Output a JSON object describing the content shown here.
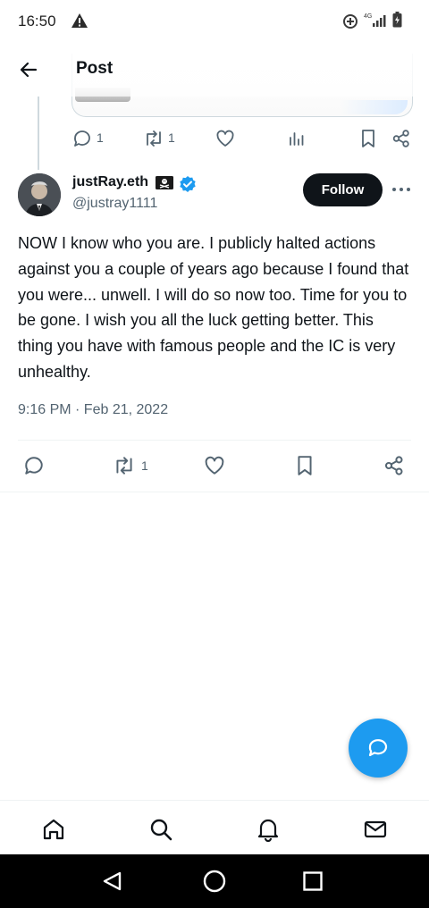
{
  "status_bar": {
    "time": "16:50",
    "network_label": "4G"
  },
  "header": {
    "title": "Post"
  },
  "quoted_post_actions": {
    "replies": "1",
    "reposts": "1"
  },
  "post": {
    "display_name": "justRay.eth",
    "handle": "@justray1111",
    "follow_label": "Follow",
    "text": "NOW I know who you are. I publicly halted actions against you a couple of years ago because I found that you were... unwell. I will do so now too. Time for you to be gone. I wish you all the luck getting better. This thing you have with famous people and the IC is very unhealthy.",
    "timestamp": "9:16 PM · Feb 21, 2022",
    "reposts": "1"
  },
  "colors": {
    "accent": "#1d9bf0",
    "text": "#0f1419",
    "muted": "#536471",
    "divider": "#eff3f4"
  },
  "icons": [
    "warning-icon",
    "data-saver-icon",
    "signal-icon",
    "battery-charging-icon",
    "back-arrow-icon",
    "reply-icon",
    "repost-icon",
    "like-icon",
    "views-icon",
    "bookmark-icon",
    "share-icon",
    "pirate-flag-icon",
    "verified-badge-icon",
    "more-icon",
    "compose-icon",
    "home-icon",
    "search-icon",
    "notifications-icon",
    "messages-icon",
    "nav-back-icon",
    "nav-home-icon",
    "nav-recents-icon"
  ]
}
